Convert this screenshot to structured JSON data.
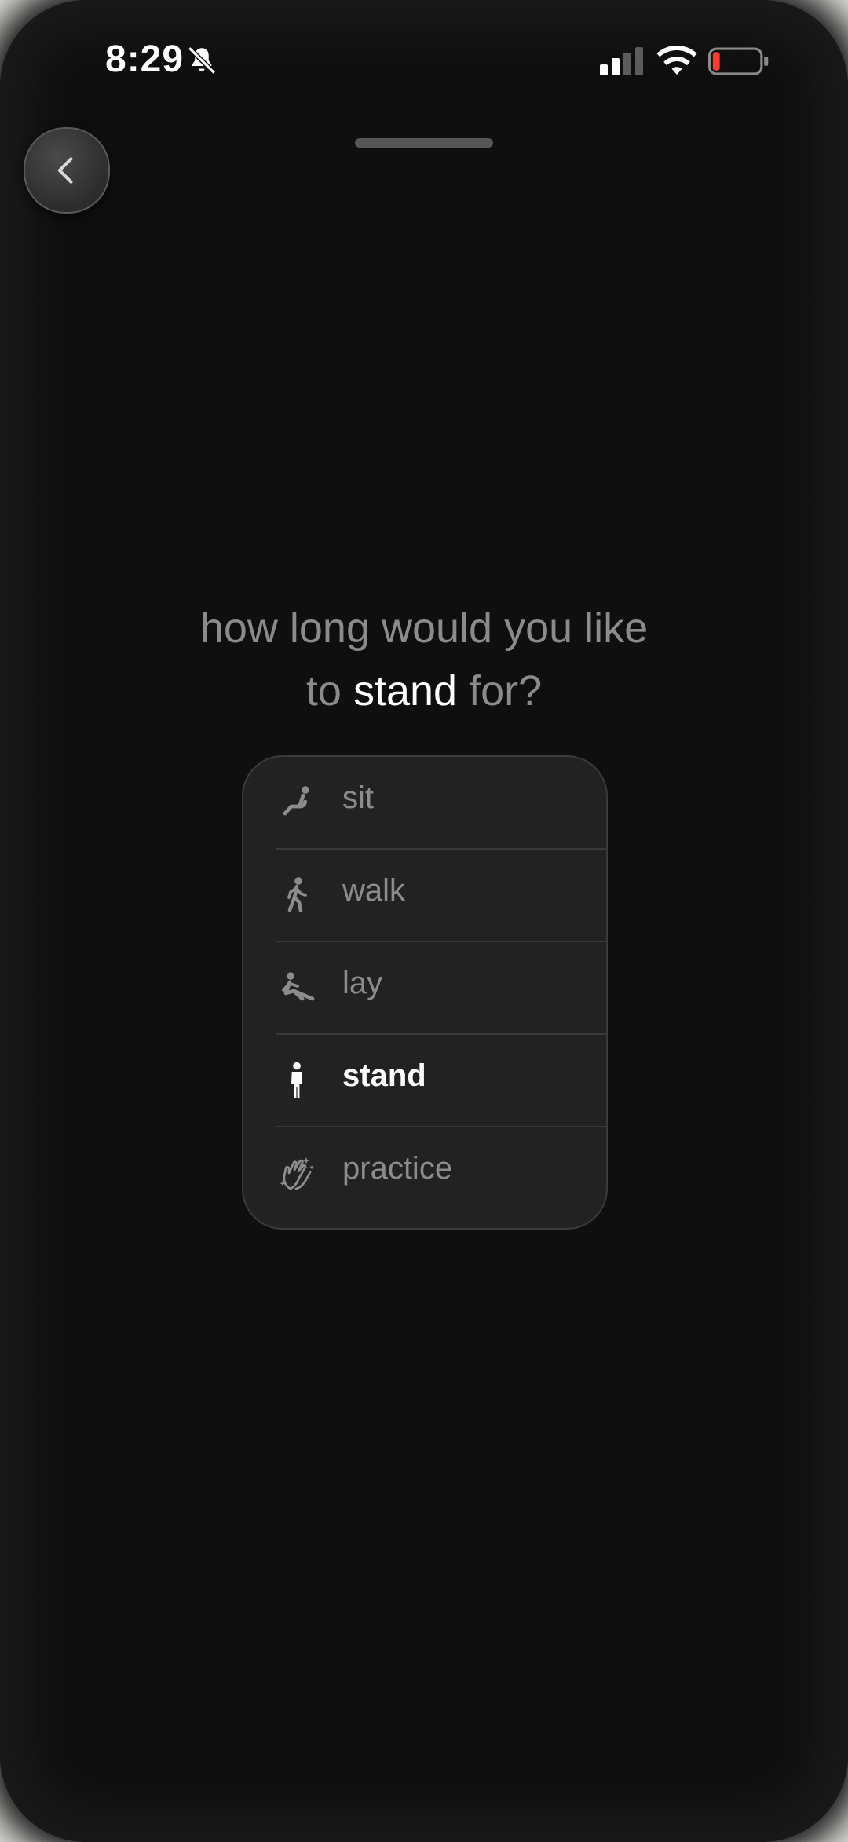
{
  "status_bar": {
    "time": "8:29",
    "icons": [
      "bell-slash-icon",
      "cellular-signal-icon",
      "wifi-icon",
      "battery-low-icon"
    ],
    "battery_color": "#ff3b30"
  },
  "navigation": {
    "back_icon": "chevron-left-icon"
  },
  "prompt": {
    "line1": "how long would you like",
    "prefix": "to",
    "activity": "stand",
    "suffix": "for?"
  },
  "picker": {
    "options": [
      {
        "label": "sit",
        "icon": "sitting-person-icon"
      },
      {
        "label": "walk",
        "icon": "walking-person-icon"
      },
      {
        "label": "lay",
        "icon": "stretching-person-icon"
      },
      {
        "label": "stand",
        "icon": "standing-person-icon"
      },
      {
        "label": "practice",
        "icon": "clapping-hands-sparkles-icon"
      }
    ],
    "selected": "stand"
  },
  "colors": {
    "background": "#0f0f0f",
    "card": "#222222",
    "muted_text": "#8b8b8b",
    "selected_text": "#ffffff"
  }
}
